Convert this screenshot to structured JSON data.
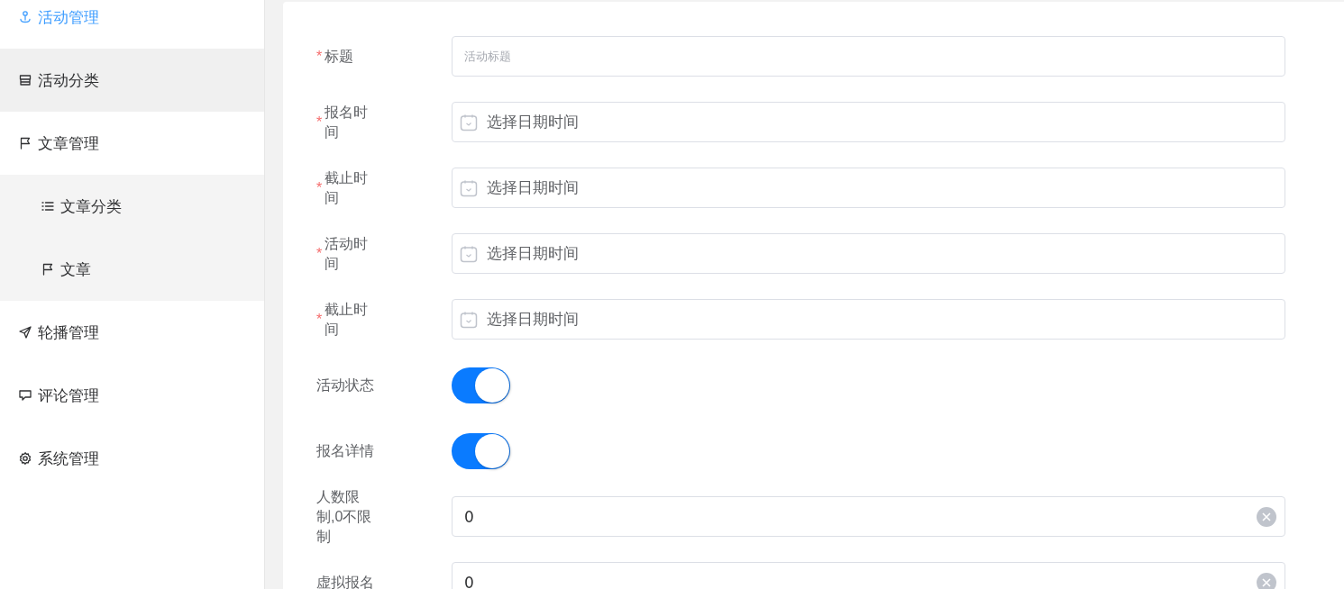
{
  "sidebar": {
    "items": [
      {
        "label": "活动管理",
        "selected": true,
        "hovered": false
      },
      {
        "label": "活动分类",
        "selected": false,
        "hovered": true
      },
      {
        "label": "文章管理",
        "selected": false,
        "hovered": false,
        "expanded": true,
        "children": [
          {
            "label": "文章分类",
            "selected": false
          },
          {
            "label": "文章",
            "selected": false
          }
        ]
      },
      {
        "label": "轮播管理",
        "selected": false,
        "hovered": false
      },
      {
        "label": "评论管理",
        "selected": false,
        "hovered": false
      },
      {
        "label": "系统管理",
        "selected": false,
        "hovered": false
      }
    ]
  },
  "form": {
    "required_mark": "*",
    "fields": [
      {
        "kind": "text",
        "label": "标题",
        "required": true,
        "placeholder": "活动标题"
      },
      {
        "kind": "date",
        "label": "报名时间",
        "required": true,
        "placeholder": "选择日期时间"
      },
      {
        "kind": "date",
        "label": "截止时间",
        "required": true,
        "placeholder": "选择日期时间"
      },
      {
        "kind": "date",
        "label": "活动时间",
        "required": true,
        "placeholder": "选择日期时间"
      },
      {
        "kind": "date",
        "label": "截止时间",
        "required": true,
        "placeholder": "选择日期时间"
      },
      {
        "kind": "switch",
        "label": "活动状态",
        "required": false,
        "on": true
      },
      {
        "kind": "switch",
        "label": "报名详情",
        "required": false,
        "on": true
      },
      {
        "kind": "number",
        "label": "人数限制,0不限制",
        "required": false,
        "value": "0"
      },
      {
        "kind": "number",
        "label": "虚拟报名",
        "required": false,
        "value": "0"
      }
    ]
  }
}
